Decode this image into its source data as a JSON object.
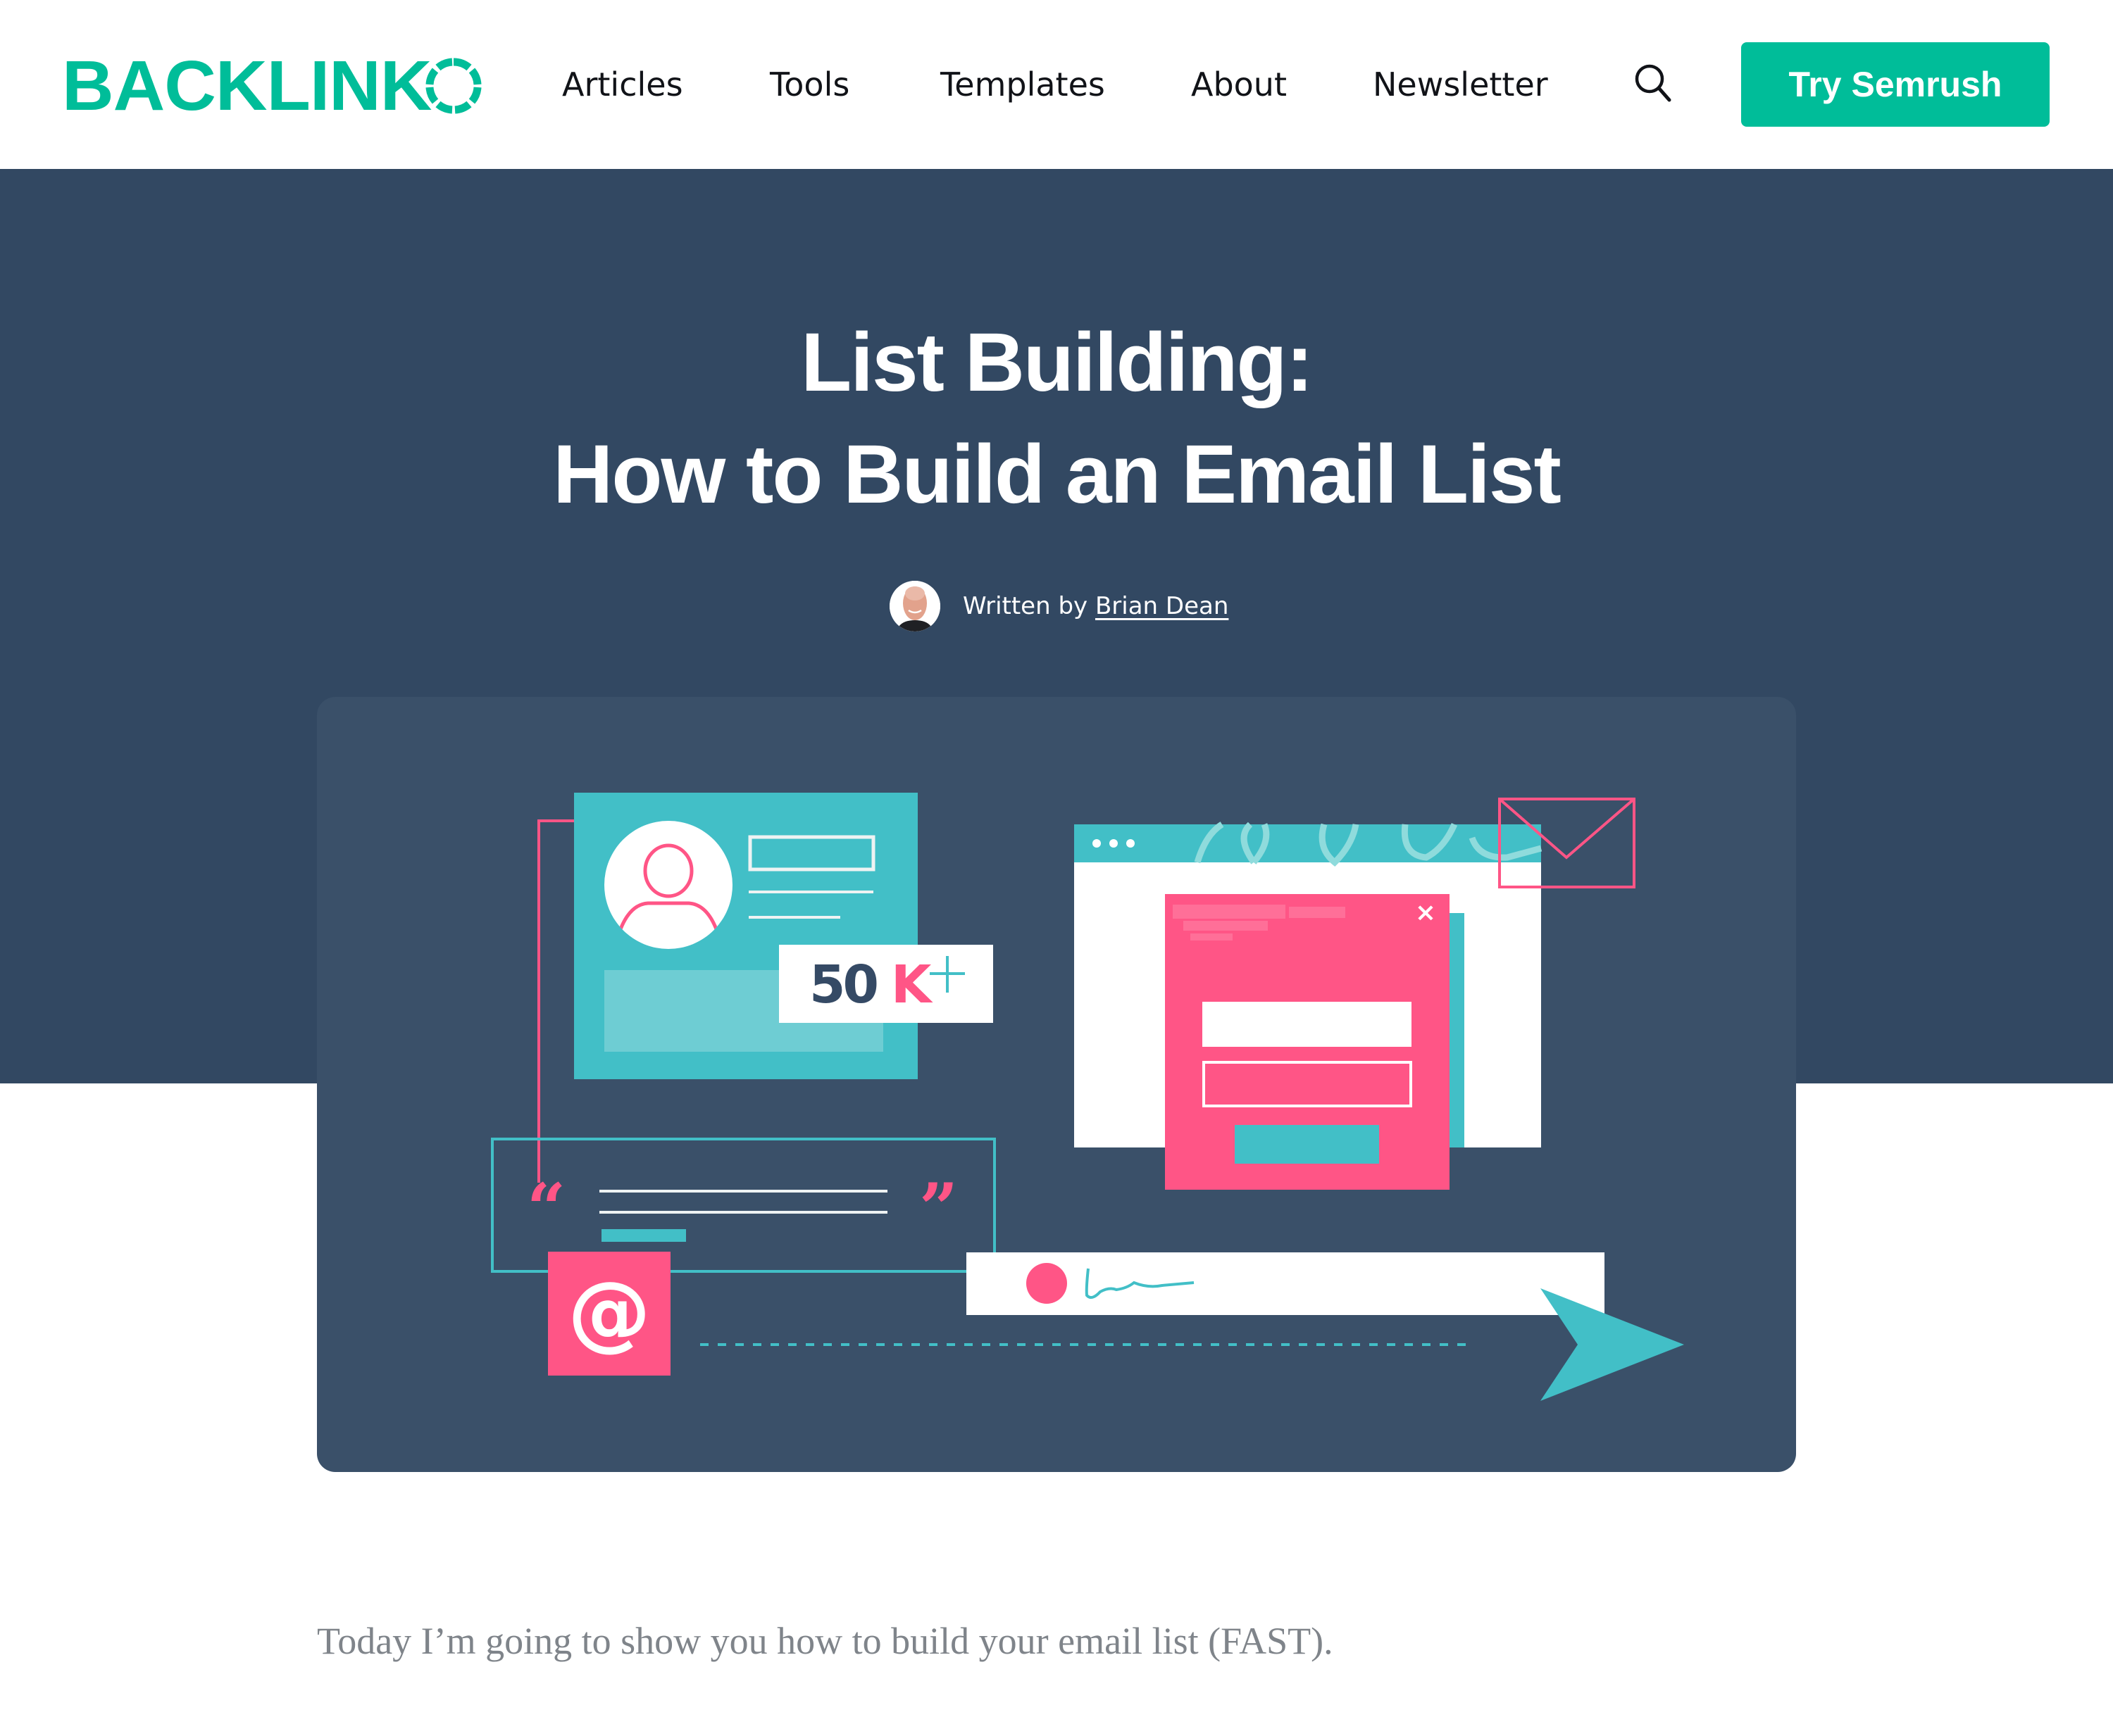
{
  "header": {
    "logo_text": "BACKLINK",
    "logo_icon": "segmented-ring-o",
    "nav": [
      {
        "label": "Articles"
      },
      {
        "label": "Tools"
      },
      {
        "label": "Templates"
      },
      {
        "label": "About"
      },
      {
        "label": "Newsletter"
      }
    ],
    "search_icon": "search-icon",
    "cta_label": "Try Semrush"
  },
  "hero": {
    "title_line1": "List Building:",
    "title_line2": "How to Build an Email List",
    "byline_prefix": "Written by",
    "author_name": "Brian Dean"
  },
  "illustration": {
    "stat_number": "50",
    "stat_unit": "K",
    "stat_plus": "+",
    "close_glyph": "×",
    "at_glyph": "@",
    "open_quote": "“",
    "close_quote": "”"
  },
  "article": {
    "intro": "Today I’m going to show you how to build your email list (FAST)."
  },
  "colors": {
    "brand": "#00bd99",
    "hero_bg": "#324862",
    "card_bg": "#3a5069",
    "teal": "#42bfc7",
    "pink": "#ff5586",
    "body_text": "#7f848a"
  }
}
